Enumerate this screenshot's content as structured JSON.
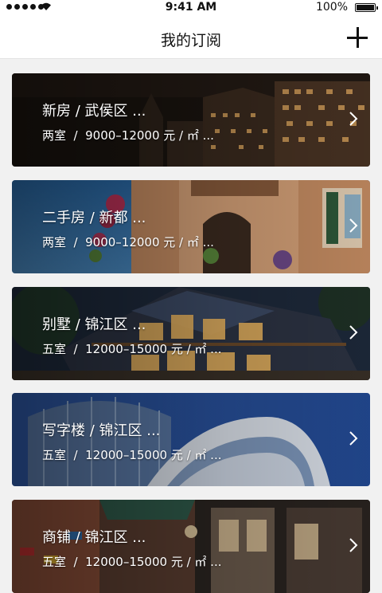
{
  "status_bar": {
    "time": "9:41 AM",
    "battery": "100%"
  },
  "nav": {
    "title": "我的订阅",
    "add_icon": "plus-icon"
  },
  "subscriptions": [
    {
      "title": "新房 / 武侯区 ...",
      "subtitle": "两室  /  9000–12000 元 / ㎡ ...",
      "scene": "night-city-building"
    },
    {
      "title": "二手房 / 新都 ...",
      "subtitle": "两室  /  9000–12000 元 / ㎡ ...",
      "scene": "old-house-with-flowers"
    },
    {
      "title": "别墅 / 锦江区 ...",
      "subtitle": "五室  /  12000–15000 元 / ㎡ ...",
      "scene": "lit-villa-at-dusk"
    },
    {
      "title": "写字楼 / 锦江区 ...",
      "subtitle": "五室  /  12000–15000 元 / ㎡ ...",
      "scene": "curved-glass-office"
    },
    {
      "title": "商铺 / 锦江区 ...",
      "subtitle": "五室  /  12000–15000 元 / ㎡ ...",
      "scene": "shopping-street"
    }
  ],
  "chevron_icon": "chevron-right-icon"
}
